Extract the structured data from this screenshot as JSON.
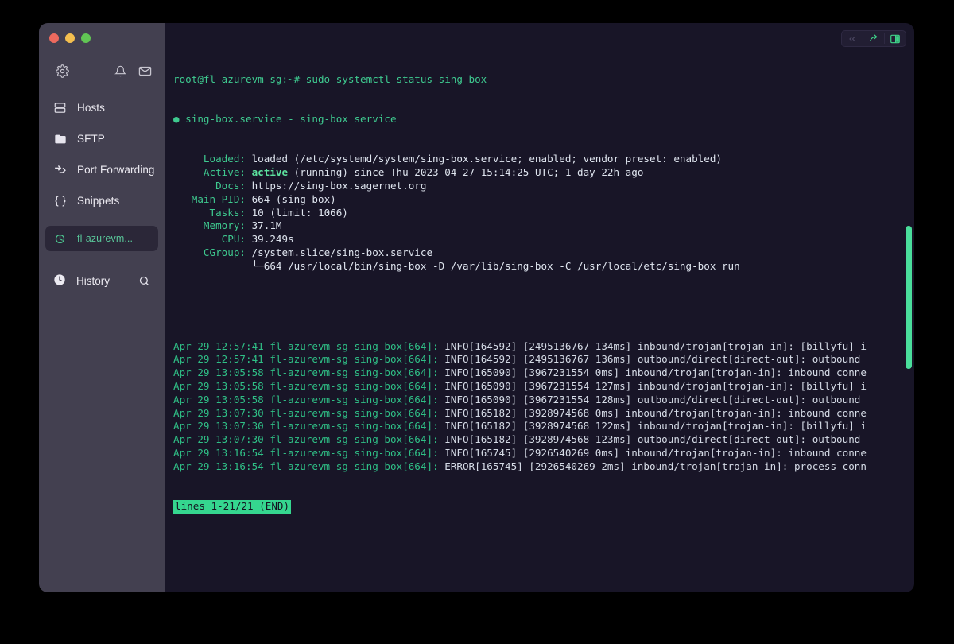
{
  "window": {
    "traffic_lights": [
      "close",
      "minimize",
      "maximize"
    ],
    "toolbar": {
      "buttons": [
        {
          "name": "prev-pane",
          "icon": "chevrons-left-icon",
          "state": "disabled"
        },
        {
          "name": "share-session",
          "icon": "share-arrow-icon",
          "state": "enabled"
        },
        {
          "name": "split-pane",
          "icon": "split-pane-icon",
          "state": "active"
        }
      ]
    }
  },
  "sidebar": {
    "top_icons": [
      {
        "label": "Settings",
        "icon": "gear-icon"
      },
      {
        "label": "Notifications",
        "icon": "bell-icon"
      },
      {
        "label": "Messages",
        "icon": "envelope-icon"
      }
    ],
    "items": [
      {
        "label": "Hosts",
        "icon": "server-icon",
        "selected": false
      },
      {
        "label": "SFTP",
        "icon": "folder-icon",
        "selected": false
      },
      {
        "label": "Port Forwarding",
        "icon": "forward-arrows-icon",
        "selected": false
      },
      {
        "label": "Snippets",
        "icon": "braces-icon",
        "selected": false
      }
    ],
    "session": {
      "label": "fl-azurevm...",
      "icon": "terminal-session-icon",
      "selected": true
    },
    "history": {
      "label": "History",
      "icon": "clock-icon",
      "search_icon": "search-icon"
    }
  },
  "terminal": {
    "prompt_line": "root@fl-azurevm-sg:~# sudo systemctl status sing-box",
    "unit_line": "sing-box.service - sing-box service",
    "status_rows": [
      {
        "key": "     Loaded: ",
        "value": "loaded (/etc/systemd/system/sing-box.service; enabled; vendor preset: enabled)"
      },
      {
        "key": "     Active: ",
        "value": "active (running) since Thu 2023-04-27 15:14:25 UTC; 1 day 22h ago",
        "highlight": "active"
      },
      {
        "key": "       Docs: ",
        "value": "https://sing-box.sagernet.org"
      },
      {
        "key": "   Main PID: ",
        "value": "664 (sing-box)"
      },
      {
        "key": "      Tasks: ",
        "value": "10 (limit: 1066)"
      },
      {
        "key": "     Memory: ",
        "value": "37.1M"
      },
      {
        "key": "        CPU: ",
        "value": "39.249s"
      },
      {
        "key": "     CGroup: ",
        "value": "/system.slice/sing-box.service"
      },
      {
        "key": "             ",
        "value": "└─664 /usr/local/bin/sing-box -D /var/lib/sing-box -C /usr/local/etc/sing-box run"
      }
    ],
    "log_lines": [
      {
        "ts": "Apr 29 12:57:41 fl-azurevm-sg sing-box[664]: ",
        "msg": "INFO[164592] [2495136767 134ms] inbound/trojan[trojan-in]: [billyfu] i"
      },
      {
        "ts": "Apr 29 12:57:41 fl-azurevm-sg sing-box[664]: ",
        "msg": "INFO[164592] [2495136767 136ms] outbound/direct[direct-out]: outbound "
      },
      {
        "ts": "Apr 29 13:05:58 fl-azurevm-sg sing-box[664]: ",
        "msg": "INFO[165090] [3967231554 0ms] inbound/trojan[trojan-in]: inbound conne"
      },
      {
        "ts": "Apr 29 13:05:58 fl-azurevm-sg sing-box[664]: ",
        "msg": "INFO[165090] [3967231554 127ms] inbound/trojan[trojan-in]: [billyfu] i"
      },
      {
        "ts": "Apr 29 13:05:58 fl-azurevm-sg sing-box[664]: ",
        "msg": "INFO[165090] [3967231554 128ms] outbound/direct[direct-out]: outbound "
      },
      {
        "ts": "Apr 29 13:07:30 fl-azurevm-sg sing-box[664]: ",
        "msg": "INFO[165182] [3928974568 0ms] inbound/trojan[trojan-in]: inbound conne"
      },
      {
        "ts": "Apr 29 13:07:30 fl-azurevm-sg sing-box[664]: ",
        "msg": "INFO[165182] [3928974568 122ms] inbound/trojan[trojan-in]: [billyfu] i"
      },
      {
        "ts": "Apr 29 13:07:30 fl-azurevm-sg sing-box[664]: ",
        "msg": "INFO[165182] [3928974568 123ms] outbound/direct[direct-out]: outbound "
      },
      {
        "ts": "Apr 29 13:16:54 fl-azurevm-sg sing-box[664]: ",
        "msg": "INFO[165745] [2926540269 0ms] inbound/trojan[trojan-in]: inbound conne"
      },
      {
        "ts": "Apr 29 13:16:54 fl-azurevm-sg sing-box[664]: ",
        "msg": "ERROR[165745] [2926540269 2ms] inbound/trojan[trojan-in]: process conn"
      }
    ],
    "pager_status": "lines 1-21/21 (END)"
  },
  "colors": {
    "terminal_bg": "#181527",
    "sidebar_bg": "#434050",
    "accent_green": "#3ec98f",
    "status_bar_bg": "#35d68f",
    "scrollbar": "#4ade9b",
    "session_selected_bg": "#2b2738"
  }
}
